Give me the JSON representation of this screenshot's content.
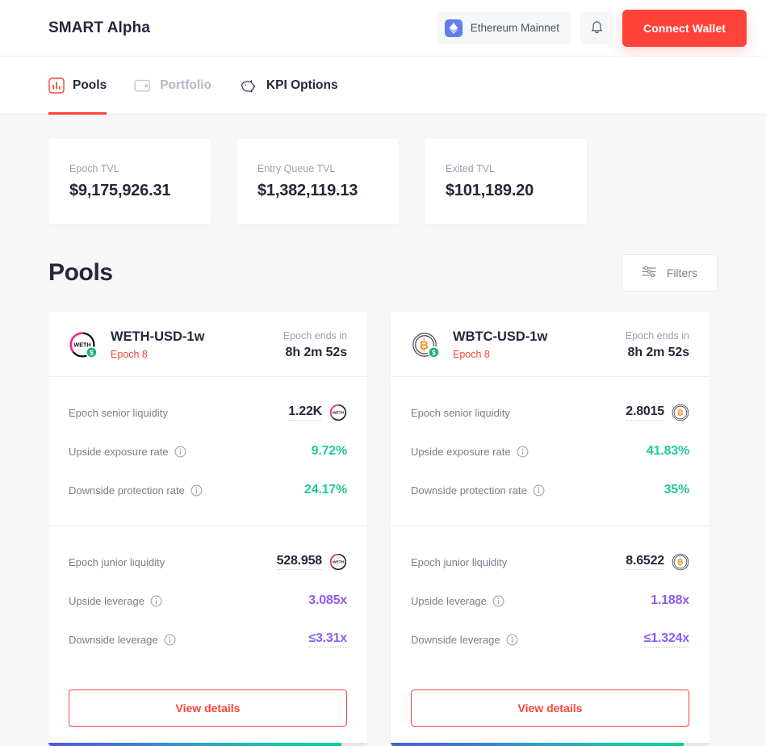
{
  "header": {
    "brand": "SMART Alpha",
    "network": {
      "name": "Ethereum Mainnet",
      "icon": "ethereum-icon",
      "color": "#627eea"
    },
    "notifications_icon": "bell-icon",
    "connect_label": "Connect Wallet",
    "connect_color": "#ff4339"
  },
  "tabs": [
    {
      "label": "Pools",
      "icon": "bar-chart-icon",
      "active": true
    },
    {
      "label": "Portfolio",
      "icon": "wallet-icon",
      "active": false
    },
    {
      "label": "KPI Options",
      "icon": "piggy-bank-icon",
      "active": false
    }
  ],
  "stats": [
    {
      "label": "Epoch TVL",
      "value": "$9,175,926.31"
    },
    {
      "label": "Entry Queue TVL",
      "value": "$1,382,119.13"
    },
    {
      "label": "Exited TVL",
      "value": "$101,189.20"
    }
  ],
  "section": {
    "title": "Pools",
    "filters_label": "Filters",
    "filters_icon": "sliders-icon"
  },
  "pools": [
    {
      "name": "WETH-USD-1w",
      "epoch": "Epoch 8",
      "token_icon": "weth-icon",
      "timer_label": "Epoch ends in",
      "timer_value": "8h 2m 52s",
      "senior": [
        {
          "label": "Epoch senior liquidity",
          "value": "1.22K",
          "style": "dark",
          "dotted": true,
          "token": true,
          "info": false
        },
        {
          "label": "Upside exposure rate",
          "value": "9.72%",
          "style": "green",
          "dotted": false,
          "token": false,
          "info": true
        },
        {
          "label": "Downside protection rate",
          "value": "24.17%",
          "style": "green",
          "dotted": false,
          "token": false,
          "info": true
        }
      ],
      "junior": [
        {
          "label": "Epoch junior liquidity",
          "value": "528.958",
          "style": "dark",
          "dotted": true,
          "token": true,
          "info": false
        },
        {
          "label": "Upside leverage",
          "value": "3.085x",
          "style": "purple",
          "dotted": false,
          "token": false,
          "info": true
        },
        {
          "label": "Downside leverage",
          "value": "≤3.31x",
          "style": "purple",
          "dotted": true,
          "token": false,
          "info": true
        }
      ],
      "view_label": "View details",
      "progress_percent": 92
    },
    {
      "name": "WBTC-USD-1w",
      "epoch": "Epoch 8",
      "token_icon": "wbtc-icon",
      "timer_label": "Epoch ends in",
      "timer_value": "8h 2m 52s",
      "senior": [
        {
          "label": "Epoch senior liquidity",
          "value": "2.8015",
          "style": "dark",
          "dotted": true,
          "token": true,
          "info": false
        },
        {
          "label": "Upside exposure rate",
          "value": "41.83%",
          "style": "green",
          "dotted": false,
          "token": false,
          "info": true
        },
        {
          "label": "Downside protection rate",
          "value": "35%",
          "style": "green",
          "dotted": false,
          "token": false,
          "info": true
        }
      ],
      "junior": [
        {
          "label": "Epoch junior liquidity",
          "value": "8.6522",
          "style": "dark",
          "dotted": true,
          "token": true,
          "info": false
        },
        {
          "label": "Upside leverage",
          "value": "1.188x",
          "style": "purple",
          "dotted": false,
          "token": false,
          "info": true
        },
        {
          "label": "Downside leverage",
          "value": "≤1.324x",
          "style": "purple",
          "dotted": true,
          "token": false,
          "info": true
        }
      ],
      "view_label": "View details",
      "progress_percent": 92
    }
  ],
  "colors": {
    "accent_red": "#ff4339",
    "green": "#20c997",
    "purple": "#8b5cf6",
    "muted": "#9b9fb0"
  }
}
